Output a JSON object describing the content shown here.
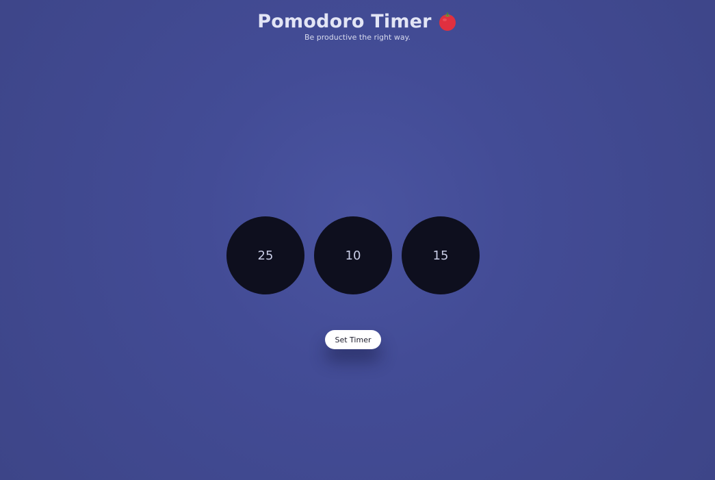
{
  "header": {
    "title": "Pomodoro Timer",
    "subtitle": "Be productive the right way.",
    "icon": "tomato-icon"
  },
  "timers": [
    {
      "value": "25"
    },
    {
      "value": "10"
    },
    {
      "value": "15"
    }
  ],
  "actions": {
    "set_timer_label": "Set Timer"
  },
  "colors": {
    "background": "#434c96",
    "circle": "#0e0f1e",
    "button": "#ffffff",
    "tomato": "#e0303f"
  }
}
